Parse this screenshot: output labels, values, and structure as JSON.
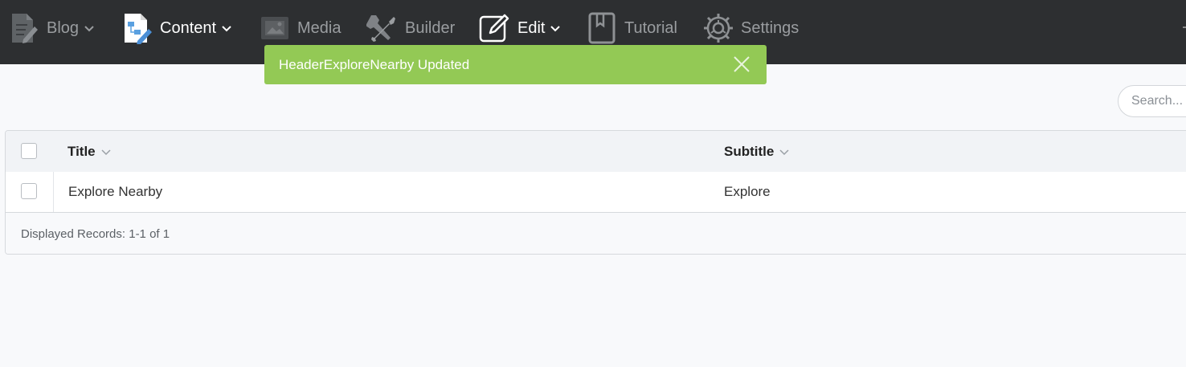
{
  "nav": {
    "items": [
      {
        "label": "Blog",
        "icon": "blog-icon",
        "dropdown": true,
        "active": false
      },
      {
        "label": "Content",
        "icon": "content-icon",
        "dropdown": true,
        "active": true
      },
      {
        "label": "Media",
        "icon": "media-icon",
        "dropdown": false,
        "active": false
      },
      {
        "label": "Builder",
        "icon": "builder-tools-icon",
        "dropdown": false,
        "active": false
      },
      {
        "label": "Edit",
        "icon": "edit-pencil-icon",
        "dropdown": true,
        "active": true
      },
      {
        "label": "Tutorial",
        "icon": "bookmark-icon",
        "dropdown": false,
        "active": false
      },
      {
        "label": "Settings",
        "icon": "gear-icon",
        "dropdown": false,
        "active": false
      }
    ]
  },
  "toast": {
    "message": "HeaderExploreNearby Updated",
    "color": "#93c955"
  },
  "search": {
    "placeholder": "Search..."
  },
  "table": {
    "columns": [
      "Title",
      "Subtitle"
    ],
    "rows": [
      {
        "title": "Explore Nearby",
        "subtitle": "Explore"
      }
    ],
    "footer": "Displayed Records: 1-1 of 1"
  },
  "colors": {
    "topbar": "#2d2f31",
    "accent": "#93c955"
  }
}
